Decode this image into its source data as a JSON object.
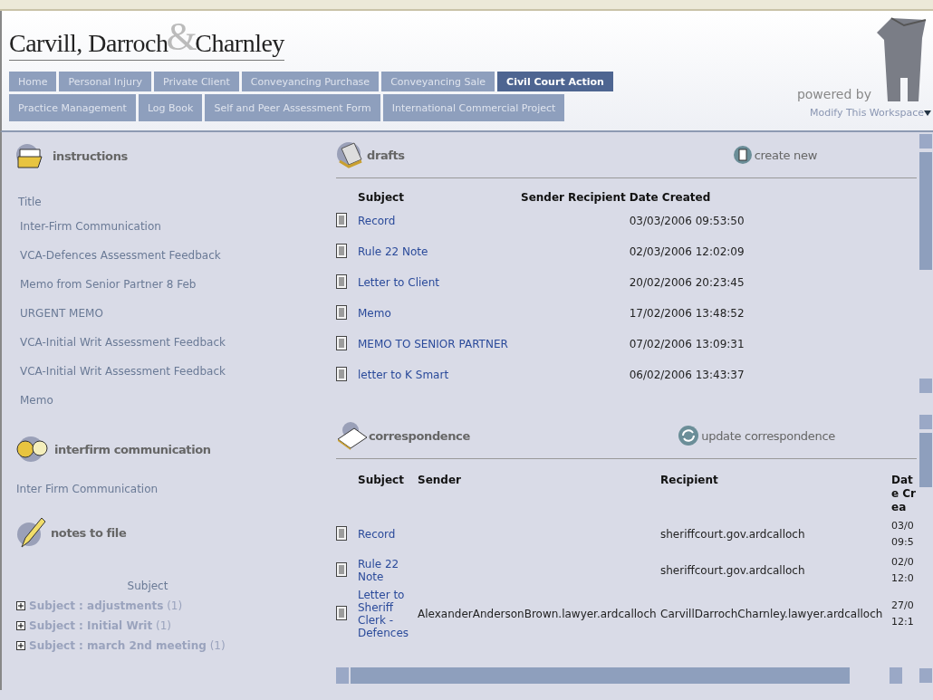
{
  "header": {
    "logo_left": "Carvill, Darroch",
    "logo_amp": "&",
    "logo_right": "Charnley",
    "powered_by": "powered by",
    "modify_link": "Modify This Workspace"
  },
  "tabs": [
    [
      {
        "label": "Home",
        "selected": false
      },
      {
        "label": "Personal Injury",
        "selected": false
      },
      {
        "label": "Private Client",
        "selected": false
      },
      {
        "label": "Conveyancing Purchase",
        "selected": false
      },
      {
        "label": "Conveyancing Sale",
        "selected": false
      },
      {
        "label": "Civil Court Action",
        "selected": true
      }
    ],
    [
      {
        "label": "Practice Management",
        "selected": false
      },
      {
        "label": "Log Book",
        "selected": false
      },
      {
        "label": "Self and Peer Assessment Form",
        "selected": false
      },
      {
        "label": "International Commercial Project",
        "selected": false
      }
    ]
  ],
  "instructions": {
    "title": "instructions",
    "column": "Title",
    "items": [
      "Inter-Firm Communication",
      "VCA-Defences Assessment Feedback",
      "Memo from Senior Partner 8 Feb",
      "URGENT MEMO",
      "VCA-Initial Writ Assessment Feedback",
      "VCA-Initial Writ Assessment Feedback",
      "Memo"
    ]
  },
  "interfirm": {
    "title": "interfirm communication",
    "items": [
      "Inter Firm Communication"
    ]
  },
  "notes": {
    "title": "notes to file",
    "column": "Subject",
    "items": [
      {
        "label": "Subject : adjustments",
        "count": "(1)",
        "expanded": false
      },
      {
        "label": "Subject : Initial Writ",
        "count": "(1)",
        "expanded": false
      },
      {
        "label": "Subject : march 2nd meeting",
        "count": "(1)",
        "expanded": false
      }
    ]
  },
  "drafts": {
    "title": "drafts",
    "action": "create new",
    "columns": [
      "Subject",
      "Sender",
      "Recipient",
      "Date Created"
    ],
    "rows": [
      {
        "subject": "Record",
        "date": "03/03/2006 09:53:50"
      },
      {
        "subject": "Rule 22 Note",
        "date": "02/03/2006 12:02:09"
      },
      {
        "subject": "Letter to Client",
        "date": "20/02/2006 20:23:45"
      },
      {
        "subject": "Memo",
        "date": "17/02/2006 13:48:52"
      },
      {
        "subject": "MEMO TO SENIOR PARTNER",
        "date": "07/02/2006 13:09:31"
      },
      {
        "subject": "letter to K Smart",
        "date": "06/02/2006 13:43:37"
      }
    ]
  },
  "correspondence": {
    "title": "correspondence",
    "action": "update correspondence",
    "columns": [
      "Subject",
      "Sender",
      "Recipient",
      "Date Crea"
    ],
    "rows": [
      {
        "subject": "Record",
        "sender": "",
        "recipient": "sheriffcourt.gov.ardcalloch",
        "date": "03/0 09:5"
      },
      {
        "subject": "Rule 22 Note",
        "sender": "",
        "recipient": "sheriffcourt.gov.ardcalloch",
        "date": "02/0 12:0"
      },
      {
        "subject": "Letter to Sheriff Clerk - Defences",
        "sender": "AlexanderAndersonBrown.lawyer.ardcalloch",
        "recipient": "CarvillDarrochCharnley.lawyer.ardcalloch",
        "date": "27/0 12:1"
      }
    ]
  }
}
